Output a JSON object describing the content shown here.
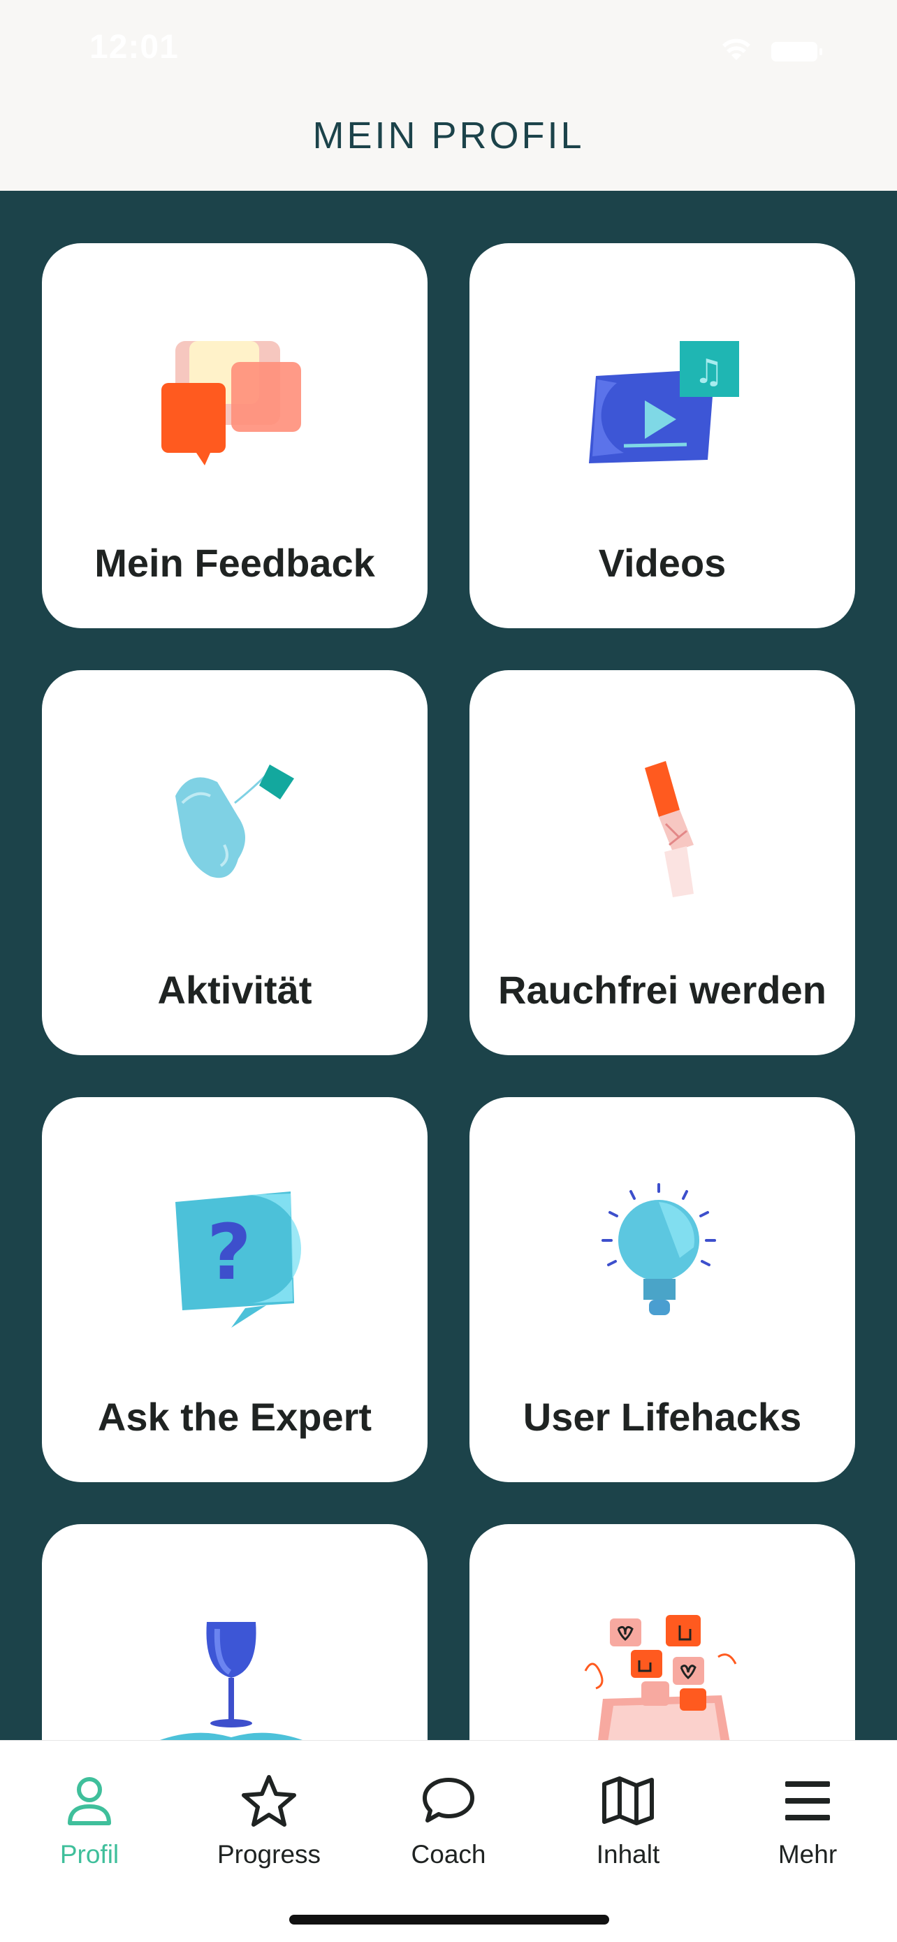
{
  "status_bar": {
    "time": "12:01"
  },
  "header": {
    "title": "MEIN PROFIL"
  },
  "cards": [
    {
      "label": "Mein Feedback",
      "icon": "speech-bubbles-illustration"
    },
    {
      "label": "Videos",
      "icon": "video-player-illustration"
    },
    {
      "label": "Aktivität",
      "icon": "running-shoe-illustration"
    },
    {
      "label": "Rauchfrei werden",
      "icon": "broken-cigarette-illustration"
    },
    {
      "label": "Ask the Expert",
      "icon": "question-bubble-illustration"
    },
    {
      "label": "User Lifehacks",
      "icon": "light-bulb-illustration"
    },
    {
      "label": "",
      "icon": "glass-on-book-illustration"
    },
    {
      "label": "",
      "icon": "reactions-tablet-illustration"
    }
  ],
  "tabbar": {
    "active": "Profil",
    "items": [
      {
        "label": "Profil",
        "icon": "person-icon"
      },
      {
        "label": "Progress",
        "icon": "star-icon"
      },
      {
        "label": "Coach",
        "icon": "chat-bubble-icon"
      },
      {
        "label": "Inhalt",
        "icon": "map-icon"
      },
      {
        "label": "Mehr",
        "icon": "hamburger-menu-icon"
      }
    ]
  },
  "colors": {
    "background": "#1c434a",
    "header_bg": "#f8f7f5",
    "active_tab": "#3fbf9b",
    "card_bg": "#ffffff"
  }
}
